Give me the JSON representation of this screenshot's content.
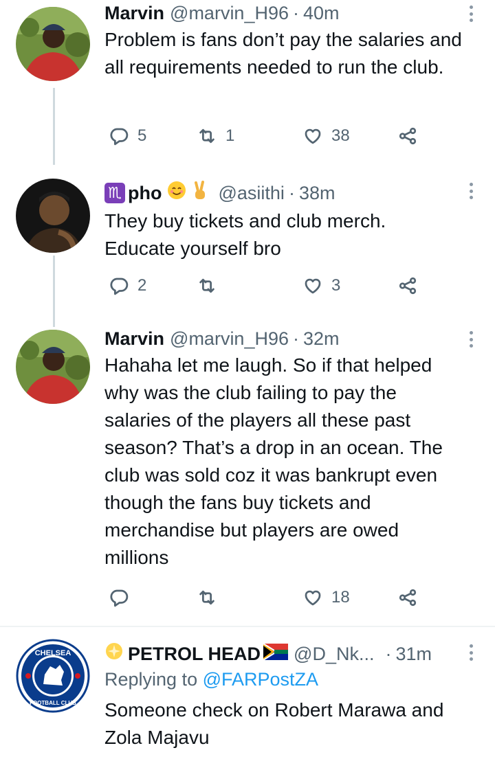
{
  "tweets": [
    {
      "name": "Marvin",
      "handle": "@marvin_H96",
      "separator": "·",
      "time": "40m",
      "text": "Problem is fans don’t pay the salaries and all requirements needed to run the club.",
      "replies": "5",
      "retweets": "1",
      "likes": "38"
    },
    {
      "name_prefix": "♏",
      "name": "pho",
      "handle": "@asiithi",
      "separator": "·",
      "time": "38m",
      "text": "They buy tickets and club merch. Educate yourself bro",
      "replies": "2",
      "retweets": "",
      "likes": "3"
    },
    {
      "name": "Marvin",
      "handle": "@marvin_H96",
      "separator": "·",
      "time": "32m",
      "text": "Hahaha let me laugh. So if that helped why was the club failing to pay the salaries of the players all these past season? That’s a drop in an ocean. The club was sold coz it was bankrupt even though the fans buy tickets and merchandise but players are owed millions",
      "replies": "",
      "retweets": "",
      "likes": "18"
    },
    {
      "name": "PETROL HEAD",
      "handle": "@D_Nk...",
      "separator": "·",
      "time": "31m",
      "replying_label": "Replying to",
      "replying_to": "@FARPostZA",
      "text": "Someone check on Robert Marawa and Zola Majavu"
    }
  ],
  "icons": [
    "reply-icon",
    "retweet-icon",
    "like-icon",
    "share-icon",
    "more-icon"
  ],
  "colors": {
    "text": "#0f1419",
    "muted": "#536471",
    "link": "#1d9bf0",
    "line": "#cfd9de"
  }
}
